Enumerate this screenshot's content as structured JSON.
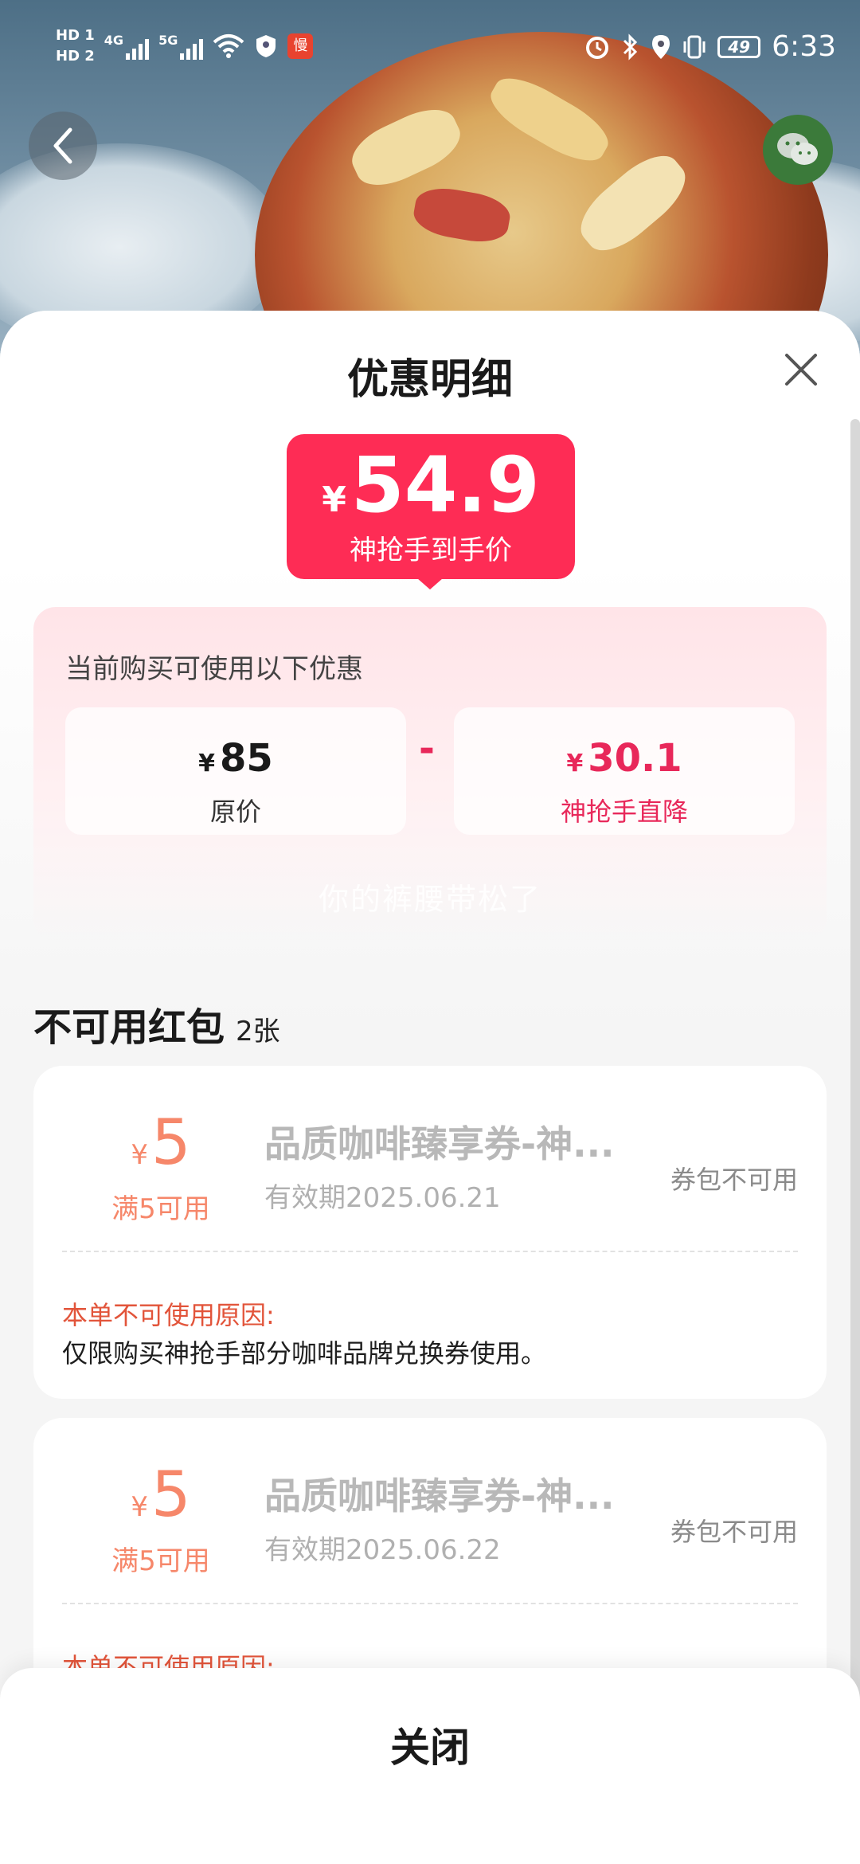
{
  "status_bar": {
    "hd1": "HD 1",
    "hd2": "HD 2",
    "net1": "4G",
    "net2": "5G",
    "app_badge": "慢",
    "battery": "49",
    "time": "6:33"
  },
  "nav": {
    "back_icon": "chevron-left-icon",
    "share_icon": "wechat-icon"
  },
  "sheet": {
    "title": "优惠明细",
    "close_icon": "close-icon"
  },
  "final_price": {
    "currency": "¥",
    "amount": "54.9",
    "label": "神抢手到手价",
    "color": "#fe2c55"
  },
  "promo": {
    "heading": "当前购买可使用以下优惠",
    "original": {
      "currency": "¥",
      "amount": "85",
      "label": "原价"
    },
    "operator": "-",
    "discount": {
      "currency": "¥",
      "amount": "30.1",
      "label": "神抢手直降"
    }
  },
  "watermark": "你的裤腰带松了",
  "unavailable": {
    "title": "不可用红包",
    "count": "2张",
    "coupons": [
      {
        "currency": "¥",
        "amount": "5",
        "condition": "满5可用",
        "name": "品质咖啡臻享券-神...",
        "valid": "有效期2025.06.21",
        "status": "券包不可用",
        "reason_title": "本单不可使用原因:",
        "reason": "仅限购买神抢手部分咖啡品牌兑换券使用。"
      },
      {
        "currency": "¥",
        "amount": "5",
        "condition": "满5可用",
        "name": "品质咖啡臻享券-神...",
        "valid": "有效期2025.06.22",
        "status": "券包不可用",
        "reason_title": "本单不可使用原因:",
        "reason": ""
      }
    ]
  },
  "footer": {
    "close_label": "关闭"
  }
}
